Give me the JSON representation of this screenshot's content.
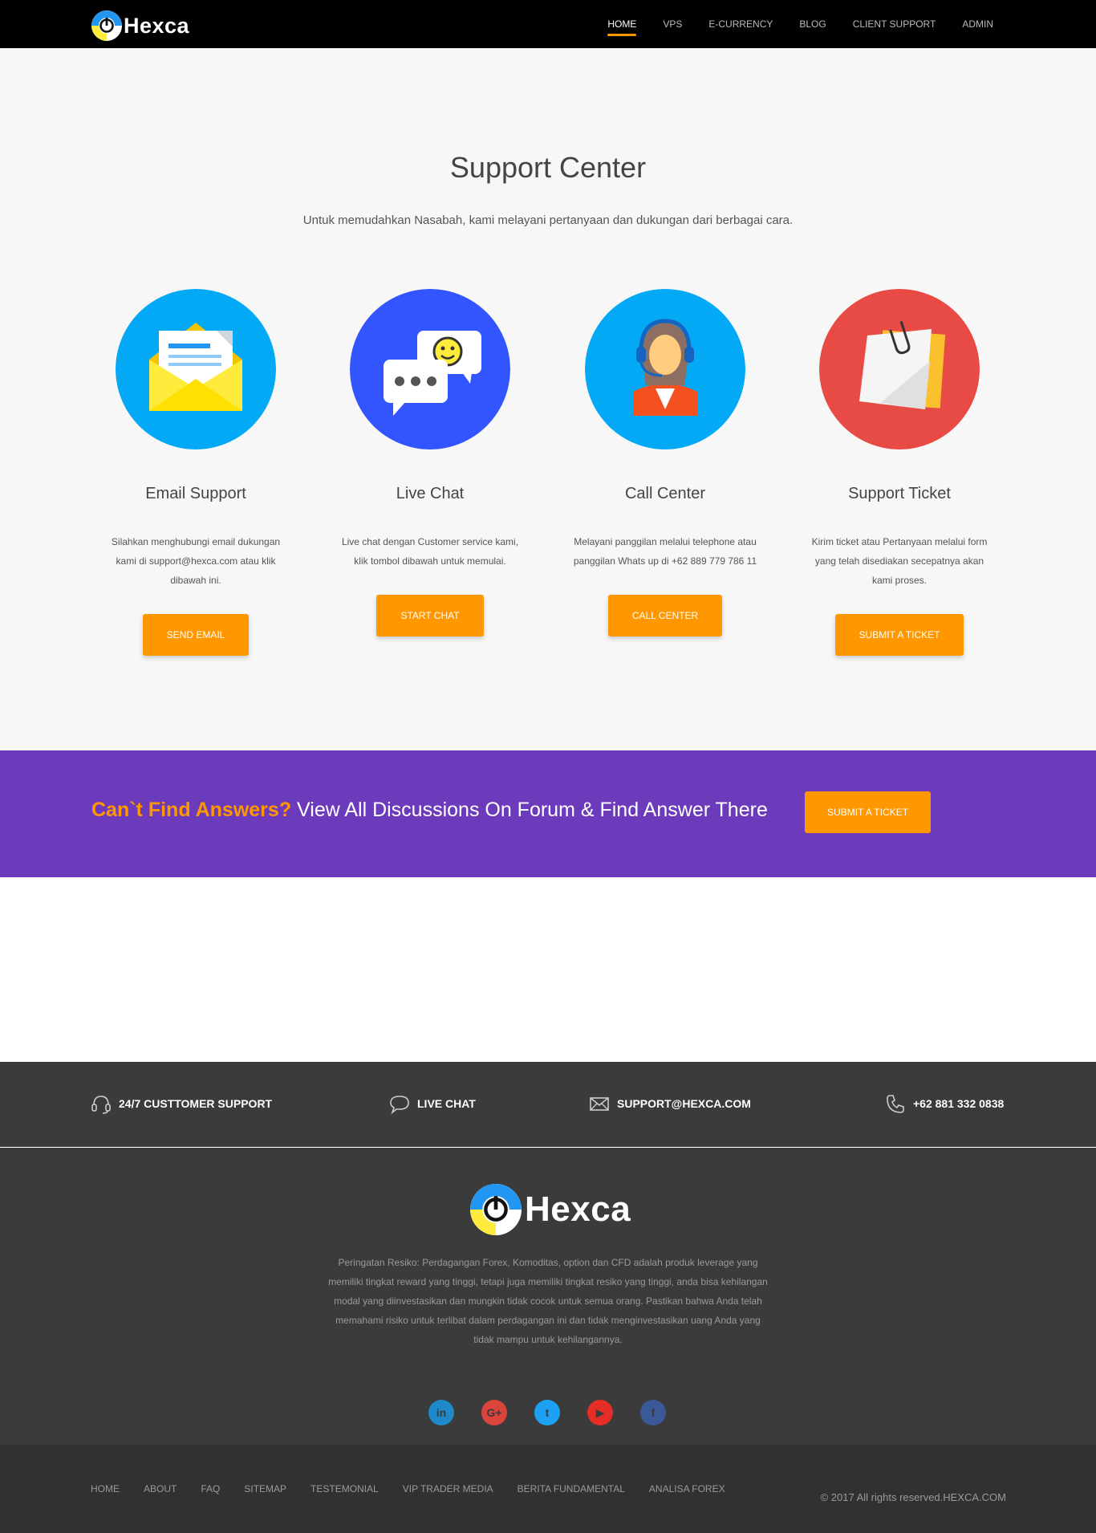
{
  "brand": {
    "name": "Hexca"
  },
  "nav": {
    "items": [
      {
        "label": "HOME",
        "active": true
      },
      {
        "label": "VPS",
        "active": false
      },
      {
        "label": "E-CURRENCY",
        "active": false
      },
      {
        "label": "BLOG",
        "active": false
      },
      {
        "label": "CLIENT SUPPORT",
        "active": false
      },
      {
        "label": "ADMIN",
        "active": false
      }
    ]
  },
  "support": {
    "title": "Support Center",
    "subtitle": "Untuk memudahkan Nasabah, kami melayani pertanyaan dan dukungan dari berbagai cara.",
    "cards": [
      {
        "icon": "envelope-icon",
        "color": "#03a9f4",
        "title": "Email Support",
        "desc": "Silahkan menghubungi email dukungan kami di support@hexca.com atau klik dibawah ini.",
        "button": "SEND EMAIL"
      },
      {
        "icon": "chat-bubbles-icon",
        "color": "#3355ff",
        "title": "Live Chat",
        "desc": "Live chat dengan Customer service kami, klik tombol dibawah untuk memulai.",
        "button": "START CHAT"
      },
      {
        "icon": "call-center-agent-icon",
        "color": "#03a9f4",
        "title": "Call Center",
        "desc": "Melayani panggilan melalui telephone atau panggilan Whats up di +62 889 779 786 11",
        "button": "CALL CENTER"
      },
      {
        "icon": "ticket-note-icon",
        "color": "#e84a46",
        "title": "Support Ticket",
        "desc": "Kirim ticket atau Pertanyaan melalui form yang telah disediakan secepatnya akan kami proses.",
        "button": "SUBMIT A TICKET"
      }
    ]
  },
  "banner": {
    "highlight": "Can`t Find Answers?",
    "text": " View All Discussions On Forum & Find Answer There",
    "button": "SUBMIT A TICKET"
  },
  "contact": {
    "support": "24/7 CUSTTOMER SUPPORT",
    "chat": "LIVE CHAT",
    "email": "SUPPORT@HEXCA.COM",
    "phone": "+62 881 332 0838"
  },
  "footer": {
    "risk": "Peringatan Resiko: Perdagangan Forex, Komoditas, option dan CFD adalah produk leverage yang memiliki tingkat reward yang tinggi, tetapi juga memiliki tingkat resiko yang tinggi, anda bisa kehilangan modal yang diinvestasikan dan mungkin tidak cocok untuk semua orang. Pastikan bahwa Anda telah memahami risiko untuk terlibat dalam perdagangan ini dan tidak menginvestasikan uang Anda yang tidak mampu untuk kehilangannya.",
    "socials": [
      {
        "icon": "linkedin-icon",
        "glyph": "in",
        "color": "#1e88c8"
      },
      {
        "icon": "google-plus-icon",
        "glyph": "G+",
        "color": "#d9453a"
      },
      {
        "icon": "twitter-icon",
        "glyph": "t",
        "color": "#1da1f2"
      },
      {
        "icon": "youtube-icon",
        "glyph": "▶",
        "color": "#e52d27"
      },
      {
        "icon": "facebook-icon",
        "glyph": "f",
        "color": "#3b5998"
      }
    ],
    "links": [
      "HOME",
      "ABOUT",
      "FAQ",
      "SITEMAP",
      "TESTEMONIAL",
      "VIP TRADER MEDIA",
      "BERITA FUNDAMENTAL",
      "ANALISA FOREX"
    ],
    "copyright": "© 2017 All rights reserved.HEXCA.COM"
  },
  "colors": {
    "accent": "#ff9800",
    "banner": "#6c3bbc",
    "footer": "#3b3b3b"
  }
}
